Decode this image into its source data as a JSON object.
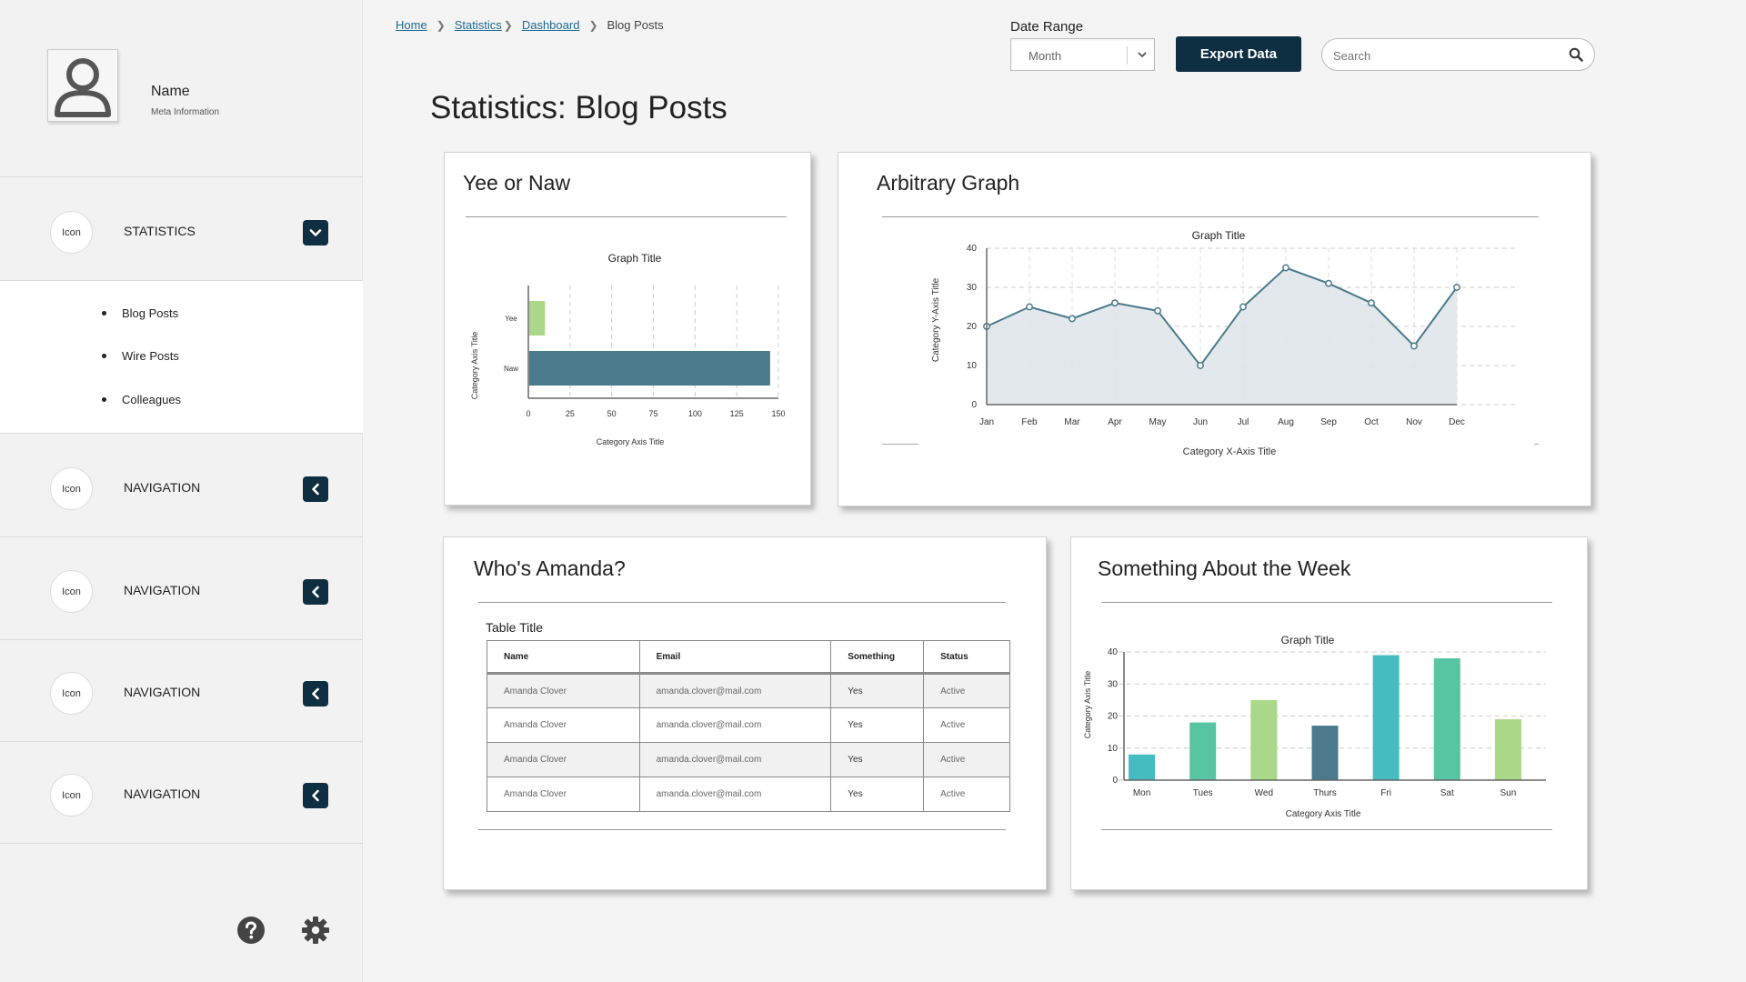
{
  "profile": {
    "name": "Name",
    "meta": "Meta Information"
  },
  "sidebar": {
    "sections": [
      {
        "icon": "Icon",
        "label": "STATISTICS",
        "expanded": true
      },
      {
        "icon": "Icon",
        "label": "NAVIGATION",
        "expanded": false
      },
      {
        "icon": "Icon",
        "label": "NAVIGATION",
        "expanded": false
      },
      {
        "icon": "Icon",
        "label": "NAVIGATION",
        "expanded": false
      },
      {
        "icon": "Icon",
        "label": "NAVIGATION",
        "expanded": false
      }
    ],
    "subitems": [
      "Blog Posts",
      "Wire Posts",
      "Colleagues"
    ],
    "bottom_icons": [
      "help-icon",
      "gear-icon"
    ]
  },
  "breadcrumb": [
    "Home",
    "Statistics",
    "Dashboard",
    "Blog Posts"
  ],
  "date_range": {
    "label": "Date Range",
    "value": "Month"
  },
  "export_label": "Export Data",
  "search": {
    "placeholder": "Search"
  },
  "page_title": "Statistics: Blog Posts",
  "colors": {
    "accent": "#0e2e42",
    "teal": "#4a7a8c",
    "green": "#a8d888",
    "cyan": "#45bcc0",
    "mint": "#57c4a4",
    "line": "#4a7a8c"
  },
  "cards": {
    "yee": {
      "title": "Yee or Naw"
    },
    "arbitrary": {
      "title": "Arbitrary Graph"
    },
    "amanda": {
      "title": "Who's Amanda?"
    },
    "week": {
      "title": "Something About the Week"
    }
  },
  "table": {
    "title": "Table Title",
    "headers": [
      "Name",
      "Email",
      "Something",
      "Status"
    ],
    "rows": [
      [
        "Amanda Clover",
        "amanda.clover@mail.com",
        "Yes",
        "Active"
      ],
      [
        "Amanda Clover",
        "amanda.clover@mail.com",
        "Yes",
        "Active"
      ],
      [
        "Amanda Clover",
        "amanda.clover@mail.com",
        "Yes",
        "Active"
      ],
      [
        "Amanda Clover",
        "amanda.clover@mail.com",
        "Yes",
        "Active"
      ]
    ]
  },
  "chart_data": [
    {
      "type": "bar",
      "orientation": "horizontal",
      "title": "Graph Title",
      "xlabel": "Category Axis Title",
      "ylabel": "Category Axis Title",
      "categories": [
        "Yee",
        "Naw"
      ],
      "values": [
        10,
        145
      ],
      "colors": [
        "#a8d888",
        "#4a7a8c"
      ],
      "xlim": [
        0,
        150
      ],
      "xticks": [
        0,
        25,
        50,
        75,
        100,
        125,
        150
      ],
      "grid": true
    },
    {
      "type": "area",
      "title": "Graph Title",
      "xlabel": "Category X-Axis Title",
      "ylabel": "Category Y-Axis Title",
      "categories": [
        "Jan",
        "Feb",
        "Mar",
        "Apr",
        "May",
        "Jun",
        "Jul",
        "Aug",
        "Sep",
        "Oct",
        "Nov",
        "Dec"
      ],
      "values": [
        20,
        25,
        22,
        26,
        24,
        10,
        25,
        35,
        31,
        26,
        15,
        30
      ],
      "ylim": [
        0,
        40
      ],
      "yticks": [
        0,
        10,
        20,
        30,
        40
      ],
      "grid": true
    },
    {
      "type": "bar",
      "title": "Graph Title",
      "xlabel": "Category Axis Title",
      "ylabel": "Category Axis Title",
      "categories": [
        "Mon",
        "Tues",
        "Wed",
        "Thurs",
        "Fri",
        "Sat",
        "Sun"
      ],
      "values": [
        8,
        18,
        25,
        17,
        39,
        38,
        19
      ],
      "colors": [
        "#45bcc0",
        "#57c4a4",
        "#a8d888",
        "#4a7a8c",
        "#45bcc0",
        "#57c4a4",
        "#a8d888"
      ],
      "ylim": [
        0,
        40
      ],
      "yticks": [
        0,
        10,
        20,
        30,
        40
      ],
      "grid": true
    }
  ]
}
